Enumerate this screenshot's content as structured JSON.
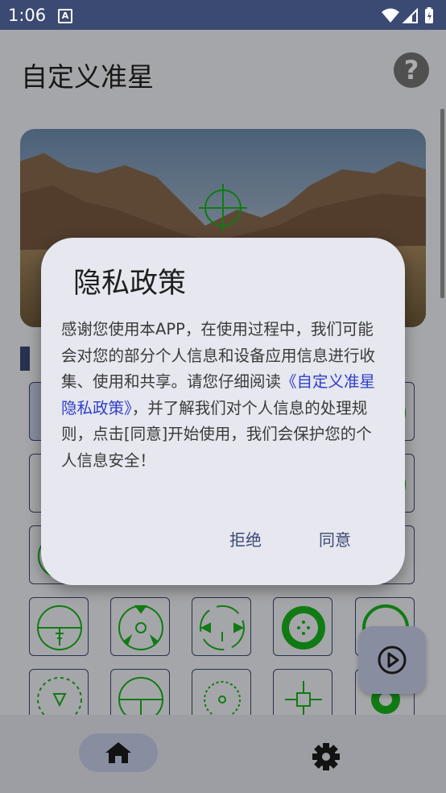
{
  "status_bar": {
    "time": "1:06",
    "notification_letter": "A"
  },
  "app": {
    "title": "自定义准星"
  },
  "dialog": {
    "title": "隐私政策",
    "body_before": "感谢您使用本APP，在使用过程中，我们可能会对您的部分个人信息和设备应用信息进行收集、使用和共享。请您仔细阅读",
    "policy_link": "《自定义准星隐私政策》",
    "body_after": "，并了解我们对个人信息的处理规则，点击[同意]开始使用，我们会保护您的个人信息安全！",
    "decline_label": "拒绝",
    "agree_label": "同意"
  },
  "icons": {
    "help": "help-circle-icon",
    "play": "play-circle-icon",
    "home": "home-icon",
    "settings": "gear-icon"
  },
  "colors": {
    "primary": "#3b4a73",
    "crosshair": "#19b51d",
    "link": "#2f3ec8",
    "dialog_bg": "#e6e7ef"
  }
}
